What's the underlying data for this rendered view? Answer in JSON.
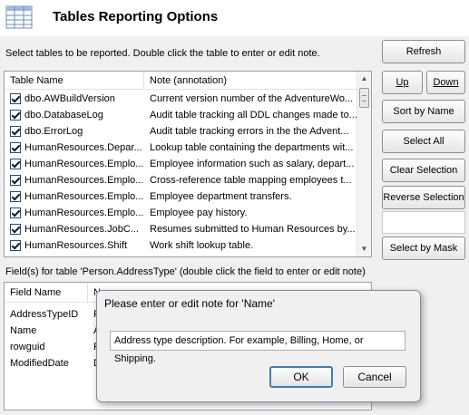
{
  "header": {
    "title": "Tables Reporting Options",
    "icon": "table-grid-icon"
  },
  "instructions": "Select tables to be reported. Double click the table to enter or edit note.",
  "tables": {
    "columns": [
      "Table Name",
      "Note (annotation)"
    ],
    "rows": [
      {
        "name": "dbo.AWBuildVersion",
        "note": "Current version number of the AdventureWo...",
        "checked": true
      },
      {
        "name": "dbo.DatabaseLog",
        "note": "Audit table tracking all DDL changes made to...",
        "checked": true
      },
      {
        "name": "dbo.ErrorLog",
        "note": "Audit table tracking errors in the the Advent...",
        "checked": true
      },
      {
        "name": "HumanResources.Depar...",
        "note": "Lookup table containing the departments wit...",
        "checked": true
      },
      {
        "name": "HumanResources.Emplo...",
        "note": "Employee information such as salary, depart...",
        "checked": true
      },
      {
        "name": "HumanResources.Emplo...",
        "note": "Cross-reference table mapping employees t...",
        "checked": true
      },
      {
        "name": "HumanResources.Emplo...",
        "note": "Employee department transfers.",
        "checked": true
      },
      {
        "name": "HumanResources.Emplo...",
        "note": "Employee pay history.",
        "checked": true
      },
      {
        "name": "HumanResources.JobC...",
        "note": "Resumes submitted to Human Resources by...",
        "checked": true
      },
      {
        "name": "HumanResources.Shift",
        "note": "Work shift lookup table.",
        "checked": true
      }
    ]
  },
  "buttons": {
    "refresh": "Refresh",
    "up": "Up",
    "down": "Down",
    "sort_by_name": "Sort by Name",
    "select_all": "Select All",
    "clear_selection": "Clear Selection",
    "reverse_selection": "Reverse Selection",
    "select_by_mask": "Select by Mask"
  },
  "fields_label": "Field(s) for table 'Person.AddressType' (double click the field to enter or edit note)",
  "fields": {
    "columns": [
      "Field Name",
      "Note (annotation)"
    ],
    "rows": [
      {
        "name": "AddressTypeID",
        "note": "P"
      },
      {
        "name": "Name",
        "note": "A"
      },
      {
        "name": "rowguid",
        "note": "R"
      },
      {
        "name": "ModifiedDate",
        "note": "D"
      }
    ],
    "header_note_partial": "No"
  },
  "dialog": {
    "title": "Please enter or edit note for 'Name'",
    "value": "Address type description. For example, Billing, Home, or Shipping.",
    "ok": "OK",
    "cancel": "Cancel"
  }
}
